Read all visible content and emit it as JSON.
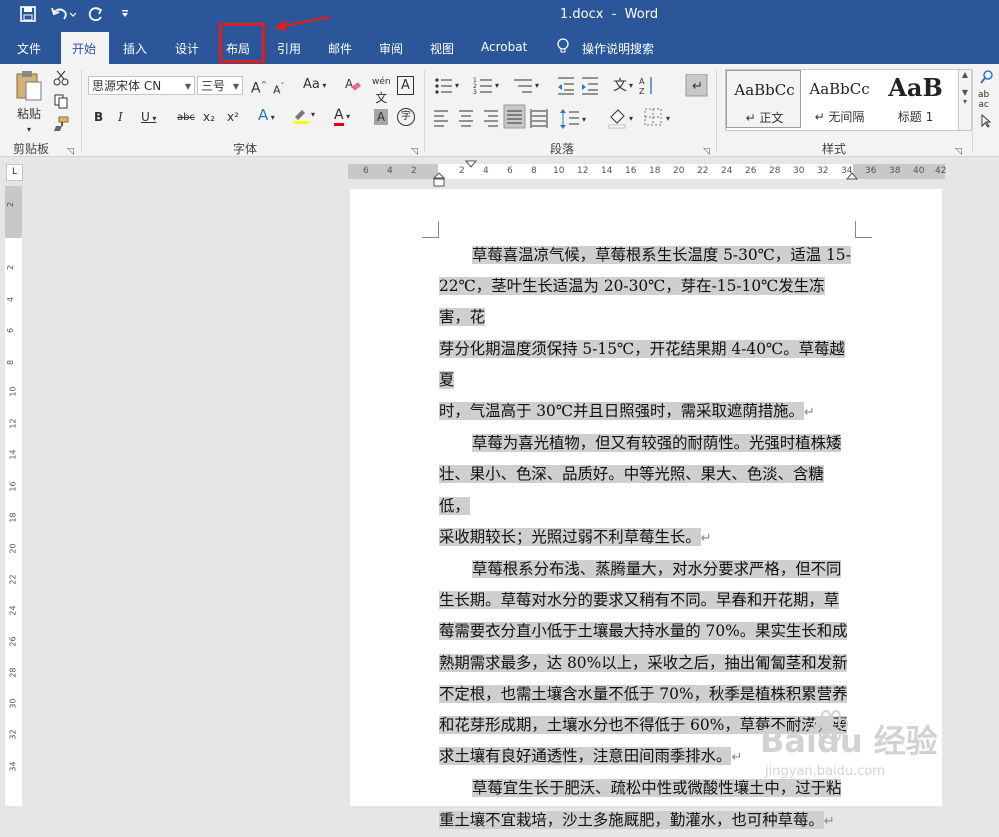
{
  "titlebar": {
    "doc_title": "1.docx  -  Word"
  },
  "tabs": {
    "file": "文件",
    "home": "开始",
    "insert": "插入",
    "design": "设计",
    "layout": "布局",
    "references": "引用",
    "mailings": "邮件",
    "review": "审阅",
    "view": "视图",
    "acrobat": "Acrobat",
    "tell_me": "操作说明搜索"
  },
  "ribbon": {
    "clipboard": {
      "paste_label": "粘贴",
      "group_label": "剪贴板"
    },
    "font": {
      "font_name": "思源宋体 CN",
      "font_size": "三号",
      "group_label": "字体",
      "bold": "B",
      "italic": "I",
      "underline": "U",
      "strike": "abc",
      "subscript": "x₂",
      "superscript": "x²",
      "grow": "A",
      "shrink": "A",
      "change_case": "Aa",
      "phonetic": "wén",
      "border_char": "A",
      "text_effects": "A",
      "font_color": "A",
      "shade_char": "A",
      "enclose": "字"
    },
    "paragraph": {
      "group_label": "段落"
    },
    "styles": {
      "group_label": "样式",
      "items": [
        {
          "sample": "AaBbCc",
          "name": "↵ 正文"
        },
        {
          "sample": "AaBbCc",
          "name": "↵ 无间隔"
        },
        {
          "sample": "AaB",
          "name": "标题 1"
        }
      ]
    }
  },
  "rulers": {
    "horizontal_ticks": [
      "6",
      "4",
      "2",
      "2",
      "4",
      "6",
      "8",
      "10",
      "12",
      "14",
      "16",
      "18",
      "20",
      "22",
      "24",
      "26",
      "28",
      "30",
      "32",
      "34",
      "36",
      "38",
      "40",
      "42"
    ],
    "vertical_ticks": [
      "2",
      "2",
      "4",
      "6",
      "8",
      "10",
      "12",
      "14",
      "16",
      "18",
      "20",
      "22",
      "24",
      "26",
      "28",
      "30",
      "32",
      "34"
    ],
    "corner": "L"
  },
  "document": {
    "paragraphs": [
      {
        "lines": [
          "草莓喜温凉气候，草莓根系生长温度 5-30℃，适温 15-",
          "22℃，茎叶生长适温为 20-30℃，芽在-15-10℃发生冻害，花",
          "芽分化期温度须保持 5-15℃，开花结果期 4-40℃。草莓越夏",
          "时，气温高于 30℃并且日照强时，需采取遮荫措施。"
        ]
      },
      {
        "lines": [
          "草莓为喜光植物，但又有较强的耐荫性。光强时植株矮",
          "壮、果小、色深、品质好。中等光照、果大、色淡、含糖低，",
          "采收期较长；光照过弱不利草莓生长。"
        ]
      },
      {
        "lines": [
          "草莓根系分布浅、蒸腾量大，对水分要求严格，但不同",
          "生长期。草莓对水分的要求又稍有不同。早春和开花期，草",
          "莓需要衣分直小低于土壤最大持水量的 70%。果实生长和成",
          "熟期需求最多，达 80%以上，采收之后，抽出匍匐茎和发新",
          "不定根，也需土壤含水量不低于 70%，秋季是植株积累营养",
          "和花芽形成期，土壤水分也不得低于 60%，草莓不耐涝，要",
          "求土壤有良好通透性，注意田间雨季排水。"
        ]
      },
      {
        "lines": [
          "草莓宜生长于肥沃、疏松中性或微酸性壤土中，过于粘",
          "重土壤不宜栽培，沙土多施厩肥，勤灌水，也可种草莓。"
        ]
      }
    ],
    "return_mark": "↵"
  },
  "watermark": {
    "main": "Baidu 经验",
    "url": "jingyan.baidu.com"
  },
  "colors": {
    "brand": "#2b579a",
    "highlight_box": "#e01e1e",
    "selection": "#cfcfcf"
  }
}
